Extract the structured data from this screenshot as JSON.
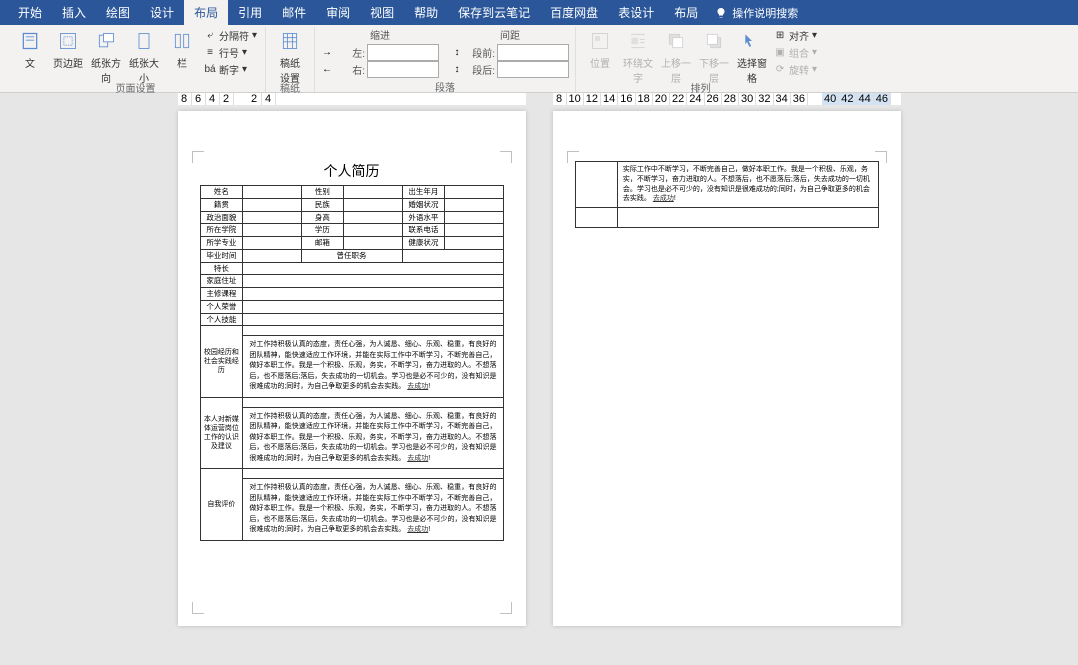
{
  "menubar": {
    "items": [
      "开始",
      "插入",
      "绘图",
      "设计",
      "布局",
      "引用",
      "邮件",
      "审阅",
      "视图",
      "帮助",
      "保存到云笔记",
      "百度网盘",
      "表设计",
      "布局"
    ],
    "active_index": 4,
    "special_start_index": 12,
    "search_placeholder": "操作说明搜索"
  },
  "ribbon": {
    "page_setup": {
      "label": "页面设置",
      "buttons": [
        "文",
        "页边距",
        "纸张方向",
        "纸张大小",
        "栏"
      ],
      "small": {
        "breaks": "分隔符",
        "line_numbers": "行号",
        "hyphenation": "断字"
      }
    },
    "manuscript": {
      "label": "稿纸",
      "button1": "稿纸\n设置",
      "button2": "稿纸"
    },
    "paragraph": {
      "label": "段落",
      "indent_header": "缩进",
      "spacing_header": "间距",
      "left": "左:",
      "right": "右:",
      "before": "段前:",
      "after": "段后:",
      "left_val": "",
      "right_val": "",
      "before_val": "",
      "after_val": ""
    },
    "arrange": {
      "label": "排列",
      "position": "位置",
      "wrap": "环绕文\n字",
      "forward": "上移一层",
      "backward": "下移一层",
      "selection_pane": "选择窗格",
      "align": "对齐",
      "group": "组合",
      "rotate": "旋转"
    }
  },
  "rulers": {
    "left": [
      "8",
      "6",
      "4",
      "2",
      "",
      "2",
      "4"
    ],
    "left_active_idx": 4,
    "right": [
      "8",
      "10",
      "12",
      "14",
      "16",
      "18",
      "20",
      "22",
      "24",
      "26",
      "28",
      "30",
      "32",
      "34",
      "36",
      "",
      "40",
      "42",
      "44",
      "46"
    ],
    "right_active_from": 15
  },
  "resume": {
    "title": "个人简历",
    "rows": [
      [
        "姓名",
        "",
        "性别",
        "",
        "出生年月",
        ""
      ],
      [
        "籍贯",
        "",
        "民族",
        "",
        "婚姻状况",
        ""
      ],
      [
        "政治面貌",
        "",
        "身高",
        "",
        "外语水平",
        ""
      ],
      [
        "所在学院",
        "",
        "学历",
        "",
        "联系电话",
        ""
      ],
      [
        "所学专业",
        "",
        "邮箱",
        "",
        "健康状况",
        ""
      ]
    ],
    "grad_row": {
      "label": "毕业时间",
      "middle_label": "曾任职务"
    },
    "single_rows": [
      "特长",
      "家庭住址",
      "主修课程",
      "个人荣誉",
      "个人技能"
    ],
    "sections": [
      {
        "label": "校园经历和社会实践经历",
        "text": "对工作持积极认真的态度，责任心强，为人诚恳、细心、乐观、稳重，有良好的团队精神，能快速适应工作环境，并能在实际工作中不断学习，不断完善自己，做好本职工作。我是一个积极、乐观，务实，不断学习，奋力进取的人。不想落后，也不愿落后;落后，失去成功的一切机会。学习也是必不可少的，没有知识是很难成功的;同时，为自己争取更多的机会去实践。",
        "link": "去成功"
      },
      {
        "label": "本人对新媒体运营岗位工作的认识及建议",
        "text": "对工作持积极认真的态度，责任心强，为人诚恳、细心、乐观、稳重，有良好的团队精神，能快速适应工作环境，并能在实际工作中不断学习，不断完善自己，做好本职工作。我是一个积极、乐观，务实，不断学习，奋力进取的人。不想落后，也不愿落后;落后，失去成功的一切机会。学习也是必不可少的，没有知识是很难成功的;同时，为自己争取更多的机会去实践。",
        "link": "去成功"
      },
      {
        "label": "自我评价",
        "text": "对工作持积极认真的态度，责任心强，为人诚恳、细心、乐观、稳重，有良好的团队精神，能快速适应工作环境，并能在实际工作中不断学习，不断完善自己，做好本职工作。我是一个积极、乐观，务实，不断学习，奋力进取的人。不想落后，也不愿落后;落后，失去成功的一切机会。学习也是必不可少的，没有知识是很难成功的;同时，为自己争取更多的机会去实践。",
        "link": "去成功"
      }
    ],
    "page2_text": "实际工作中不断学习，不断完善自己，做好本职工作。我是一个积极、乐观，务实，不断学习，奋力进取的人。不想落后，也不愿落后;落后，失去成功的一切机会。学习也是必不可少的，没有知识是很难成功的;同时，为自己争取更多的机会去实践。",
    "page2_link": "去成功"
  }
}
